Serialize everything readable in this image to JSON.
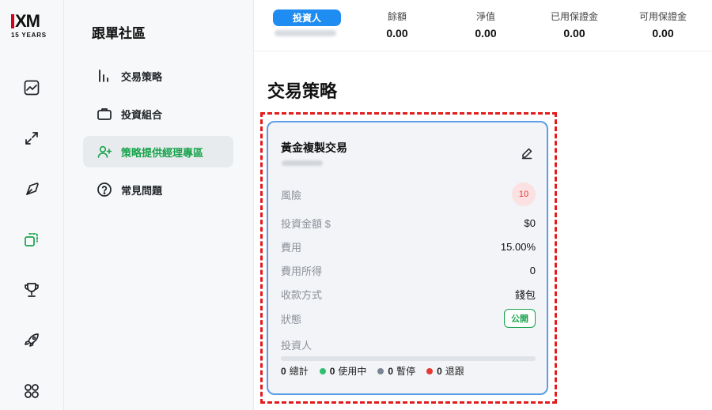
{
  "logo": {
    "mark": "XM",
    "sub": "15 YEARS"
  },
  "rail": {
    "icons": [
      "chart-icon",
      "arrows-icon",
      "compass-icon",
      "copy-icon",
      "trophy-icon",
      "rocket-icon",
      "grid-icon"
    ],
    "active_icon": "copy-icon",
    "accent": "#16a34a"
  },
  "sidebar": {
    "title": "跟單社區",
    "items": [
      {
        "label": "交易策略",
        "icon": "bar-chart-icon",
        "active": false
      },
      {
        "label": "投資組合",
        "icon": "briefcase-icon",
        "active": false
      },
      {
        "label": "策略提供經理專區",
        "icon": "user-plus-icon",
        "active": true
      },
      {
        "label": "常見問題",
        "icon": "question-icon",
        "active": false
      }
    ]
  },
  "topbar": {
    "account_type": "投資人",
    "stats": [
      {
        "label": "餘額",
        "value": "0.00"
      },
      {
        "label": "淨值",
        "value": "0.00"
      },
      {
        "label": "已用保證金",
        "value": "0.00"
      },
      {
        "label": "可用保證金",
        "value": "0.00"
      }
    ]
  },
  "page": {
    "title": "交易策略"
  },
  "card": {
    "title": "黃金複製交易",
    "rows": {
      "risk": {
        "label": "風險",
        "value": "10"
      },
      "investment": {
        "label": "投資金額 $",
        "value": "$0"
      },
      "fee": {
        "label": "費用",
        "value": "15.00%"
      },
      "fee_income": {
        "label": "費用所得",
        "value": "0"
      },
      "payout": {
        "label": "收款方式",
        "value": "錢包"
      },
      "status": {
        "label": "狀態",
        "value": "公開"
      },
      "investors": {
        "label": "投資人"
      }
    },
    "legend": [
      {
        "count": "0",
        "label": "總計",
        "color": ""
      },
      {
        "count": "0",
        "label": "使用中",
        "color": "#2fbf71"
      },
      {
        "count": "0",
        "label": "暫停",
        "color": "#7b8591"
      },
      {
        "count": "0",
        "label": "退跟",
        "color": "#e53935"
      }
    ],
    "border_color": "#5b9ee6"
  },
  "highlight_color": "#e21b1b"
}
